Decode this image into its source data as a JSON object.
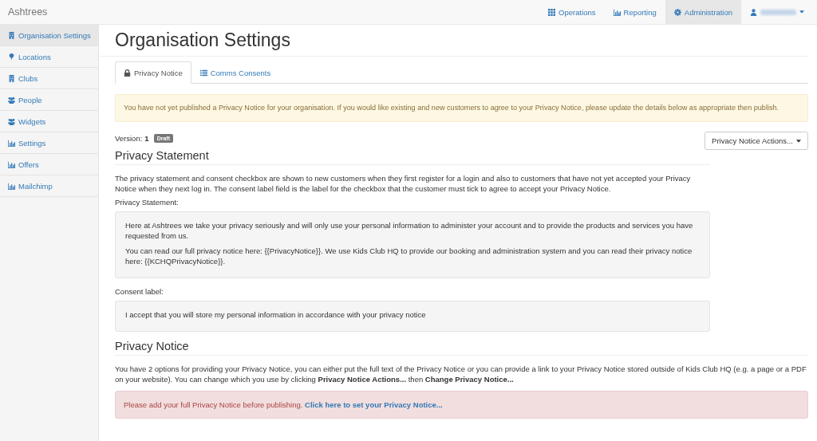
{
  "navbar": {
    "brand": "Ashtrees",
    "items": [
      {
        "kind": "grid",
        "label": "Operations",
        "selected": false
      },
      {
        "kind": "chart",
        "label": "Reporting",
        "selected": false
      },
      {
        "kind": "gear",
        "label": "Administration",
        "selected": true
      }
    ],
    "user_menu": {
      "name_hidden": true
    }
  },
  "sidebar": {
    "items": [
      {
        "kind": "building",
        "label": "Organisation Settings",
        "selected": true
      },
      {
        "kind": "pin",
        "label": "Locations",
        "selected": false
      },
      {
        "kind": "building",
        "label": "Clubs",
        "selected": false
      },
      {
        "kind": "people",
        "label": "People",
        "selected": false
      },
      {
        "kind": "people",
        "label": "Widgets",
        "selected": false
      },
      {
        "kind": "chart",
        "label": "Settings",
        "selected": false
      },
      {
        "kind": "chart",
        "label": "Offers",
        "selected": false
      },
      {
        "kind": "chart",
        "label": "Mailchimp",
        "selected": false
      }
    ]
  },
  "page": {
    "title": "Organisation Settings",
    "tabs": [
      {
        "kind": "lock",
        "label": "Privacy Notice",
        "selected": true
      },
      {
        "kind": "list",
        "label": "Comms Consents",
        "selected": false
      }
    ],
    "warning": "You have not yet published a Privacy Notice for your organisation. If you would like existing and new customers to agree to your Privacy Notice, please update the details below as appropriate then publish.",
    "version_label": "Version:",
    "version": "1",
    "status_badge": "Draft",
    "actions_button": "Privacy Notice Actions...",
    "statement_section": {
      "heading": "Privacy Statement",
      "description": "The privacy statement and consent checkbox are shown to new customers when they first register for a login and also to customers that have not yet accepted your Privacy Notice when they next log in. The consent label field is the label for the checkbox that the customer must tick to agree to accept your Privacy Notice.",
      "statement_label": "Privacy Statement:",
      "statement_paragraphs": [
        "Here at Ashtrees we take your privacy seriously and will only use your personal information to administer your account and to provide the products and services you have requested from us.",
        "You can read our full privacy notice here: {{PrivacyNotice}}. We use Kids Club HQ to provide our booking and administration system and you can read their privacy notice here: {{KCHQPrivacyNotice}}."
      ],
      "consent_label": "Consent label:",
      "consent_text": "I accept that you will store my personal information in accordance with your privacy notice"
    },
    "notice_section": {
      "heading": "Privacy Notice",
      "description": "You have 2 options for providing your Privacy Notice, you can either put the full text of the Privacy Notice or you can provide a link to your Privacy Notice stored outside of Kids Club HQ (e.g. a page or a PDF on your website). You can change which you use by clicking **Privacy Notice Actions...** then **Change Privacy Notice...**",
      "error": "Please add your full Privacy Notice before publishing.",
      "error_link": "Click here to set your Privacy Notice..."
    }
  }
}
